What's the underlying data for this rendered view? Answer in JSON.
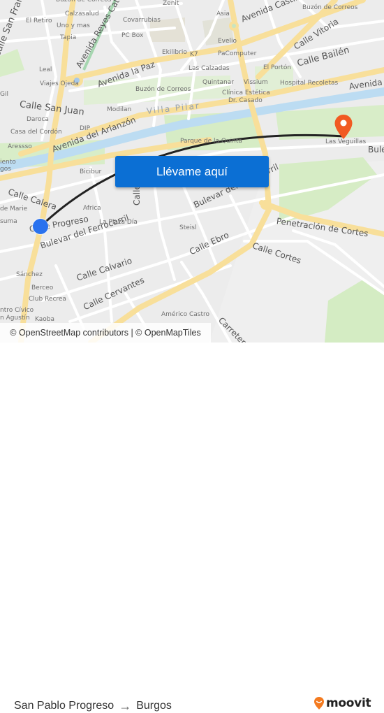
{
  "map": {
    "button_label": "Llévame aquí",
    "attribution": "© OpenStreetMap contributors | © OpenMapTiles",
    "origin_marker": "origin-dot",
    "destination_marker": "destination-pin",
    "colors": {
      "route": "#222222",
      "origin": "#2a72ee",
      "destination": "#f15a22",
      "button": "#0b6fd4",
      "major_road": "#fbe3a0",
      "water": "#bcdcf2",
      "park": "#d4ecc3"
    },
    "streets": [
      "Calle San Francisco",
      "Avenida Reyes Católicos",
      "Avenida la Paz",
      "Calle San Juan",
      "Avenida Castilla",
      "Calle Vitoria",
      "Calle Bailén",
      "Avenida",
      "Avenida del Arlanzón",
      "Calle Calera",
      "Calle Progreso",
      "Bulevar del Ferrocarril",
      "Bulevar del Ferrocarril",
      "Calle",
      "Calle Calvario",
      "Calle Cervantes",
      "Calle Ebro",
      "Calle Cortes",
      "Penetración de Cortes",
      "Carretera de",
      "Bule"
    ],
    "district": "Villa Pilar",
    "pois": [
      "Buzón de Correos",
      "Zenit",
      "Calzasalud",
      "El Retiro",
      "Uno y mas",
      "Covarrubias",
      "Tapia",
      "PC Box",
      "Ekilibrio",
      "K7",
      "Asia",
      "Buzón de Correos",
      "Evelio",
      "PaComputer",
      "Las Calzadas",
      "El Portón",
      "Leal",
      "Viajes Ojeda",
      "Quintanar",
      "Vissium",
      "Hospital Recoletas",
      "Clínica Estética",
      "Dr. Casado",
      "Buzón de Correos",
      "Modilan",
      "Gil",
      "Daroca",
      "DIP",
      "Casa del Cordón",
      "Aressso",
      "Parque de la Quinta",
      "Las Veguillas",
      "Bicibur",
      "iento",
      "gos",
      "de Marie",
      "Africa",
      "suma",
      "La Plaza Día",
      "Steisl",
      "Sánchez",
      "Berceo",
      "Club Recrea",
      "ntro Cívico",
      "n Agustín",
      "Kaoba",
      "Américo Castro"
    ]
  },
  "footer": {
    "origin": "San Pablo Progreso",
    "arrow": "→",
    "destination": "Burgos",
    "brand": "moovit"
  }
}
